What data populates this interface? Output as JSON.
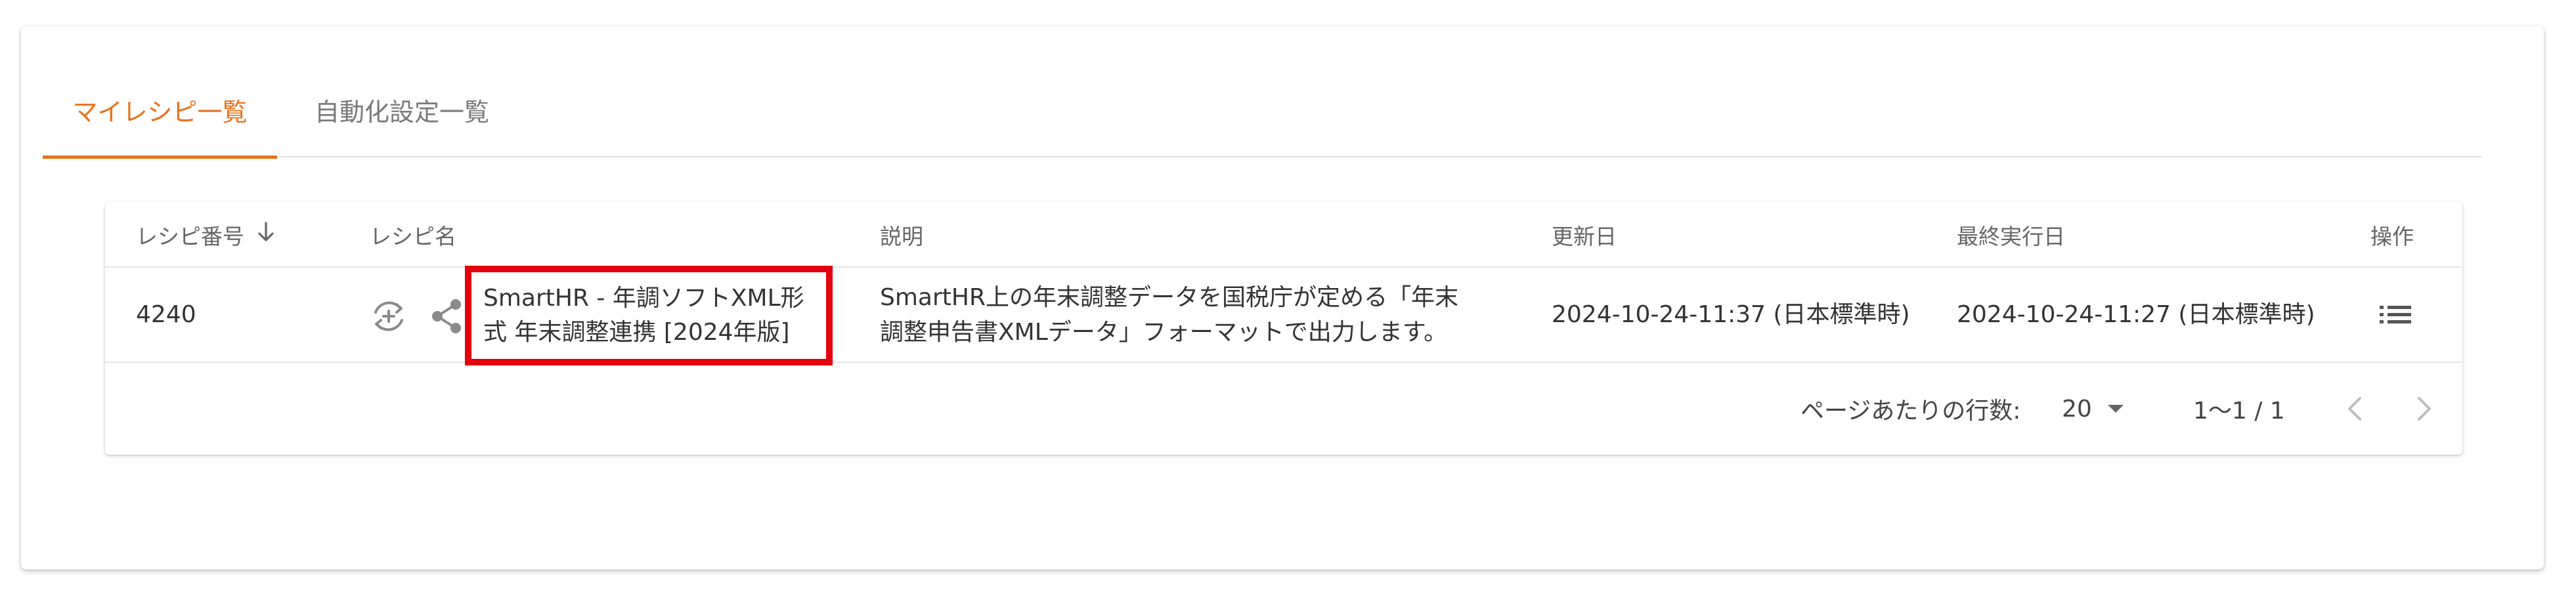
{
  "tabs": [
    {
      "label": "マイレシピ一覧",
      "active": true
    },
    {
      "label": "自動化設定一覧",
      "active": false
    }
  ],
  "table": {
    "headers": {
      "recipe_number": "レシピ番号",
      "recipe_name": "レシピ名",
      "description": "説明",
      "updated": "更新日",
      "last_run": "最終実行日",
      "actions": "操作"
    },
    "rows": [
      {
        "recipe_number": "4240",
        "name_line1": "SmartHR - 年調ソフトXML形",
        "name_line2": "式 年末調整連携 [2024年版]",
        "desc_line1": "SmartHR上の年末調整データを国税庁が定める「年末",
        "desc_line2": "調整申告書XMLデータ」フォーマットで出力します。",
        "updated": "2024-10-24-11:37 (日本標準時)",
        "last_run": "2024-10-24-11:27 (日本標準時)"
      }
    ]
  },
  "pagination": {
    "rows_per_page_label": "ページあたりの行数:",
    "rows_per_page_value": "20",
    "range": "1〜1 / 1"
  },
  "colors": {
    "accent": "#e9711c",
    "highlight_box": "#e3000f"
  },
  "icons": {
    "sort": "arrow-down-icon",
    "sync": "sync-add-icon",
    "share": "share-icon",
    "menu": "list-menu-icon",
    "dropdown": "caret-down-icon",
    "prev": "chevron-left-icon",
    "next": "chevron-right-icon"
  }
}
